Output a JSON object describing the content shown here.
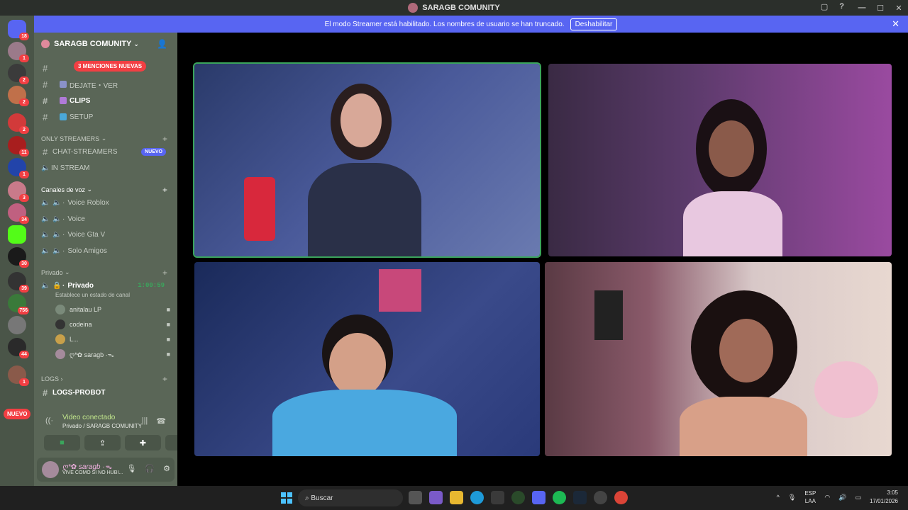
{
  "window": {
    "title": "SARAGB COMUNITY"
  },
  "banner": {
    "text": "El modo Streamer está habilitado. Los nombres de usuario se han truncado.",
    "button": "Deshabilitar"
  },
  "servers": [
    {
      "badge": "18"
    },
    {
      "badge": "1"
    },
    {
      "badge": "2"
    },
    {
      "badge": "2"
    },
    {
      "badge": "2"
    },
    {
      "badge": "11"
    },
    {
      "badge": "1"
    },
    {
      "badge": "3"
    },
    {
      "badge": "34"
    },
    {
      "badge": ""
    },
    {
      "badge": "30"
    },
    {
      "badge": "39"
    },
    {
      "badge": "756"
    },
    {
      "badge": ""
    },
    {
      "badge": "44"
    },
    {
      "badge": "1"
    }
  ],
  "servers_nuevo": "NUEVO",
  "sidebar": {
    "server_name": "SARAGB COMUNITY",
    "mentions": "3 MENCIONES NUEVAS",
    "top_channels": [
      {
        "label": "DEJATE・VER"
      },
      {
        "label": "CLIPS"
      },
      {
        "label": "SETUP"
      }
    ],
    "cat_streamers": "ONLY STREAMERS",
    "chat_streamers": "CHAT-STREAMERS",
    "chat_badge": "NUEVO",
    "in_stream": "IN STREAM",
    "cat_voz": "Canales de voz",
    "voice_channels": [
      {
        "label": "Voice Roblox"
      },
      {
        "label": "Voice"
      },
      {
        "label": "Voice Gta V"
      },
      {
        "label": "Solo Amigos"
      }
    ],
    "cat_privado": "Privado",
    "privado": "Privado",
    "privado_time": "1:00:59",
    "privado_status": "Establece un estado de canal",
    "voice_users": [
      {
        "name": "anitalau",
        "tag": "LP"
      },
      {
        "name": "codeina",
        "tag": ""
      },
      {
        "name": "L...",
        "tag": ""
      },
      {
        "name": "ღ*✿ saragb ·ᯓ",
        "tag": ""
      }
    ],
    "cat_logs": "LOGS",
    "logs_probot": "LOGS-PROBOT"
  },
  "voice_panel": {
    "title": "Video conectado",
    "subtitle": "Privado / SARAGB COMUNITY"
  },
  "user_panel": {
    "name": "ღ*✿ saragb ·ᯓ",
    "status": "VIVE COMO SI NO HUBI..."
  },
  "taskbar": {
    "search": "Buscar",
    "lang1": "ESP",
    "lang2": "LAA",
    "time": "3:05",
    "date": "17/01/2026"
  }
}
